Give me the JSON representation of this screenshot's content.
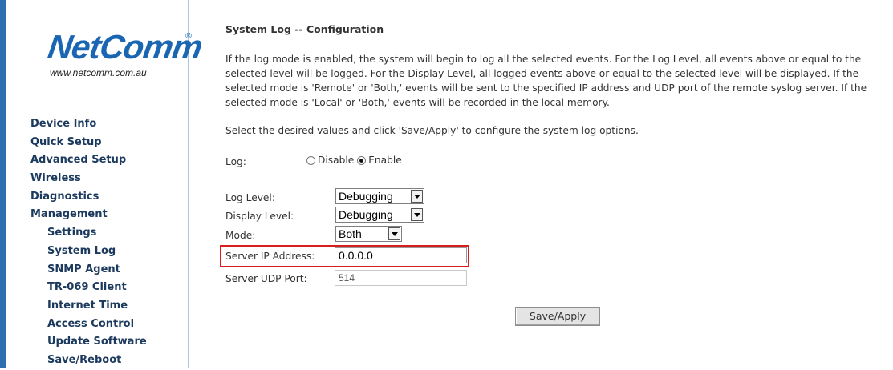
{
  "sidebar": {
    "logo_text": "NetComm",
    "logo_reg": "®",
    "logo_url": "www.netcomm.com.au",
    "items": [
      {
        "label": "Device Info"
      },
      {
        "label": "Quick Setup"
      },
      {
        "label": "Advanced Setup"
      },
      {
        "label": "Wireless"
      },
      {
        "label": "Diagnostics"
      },
      {
        "label": "Management"
      }
    ],
    "subitems": [
      {
        "label": "Settings"
      },
      {
        "label": "System Log"
      },
      {
        "label": "SNMP Agent"
      },
      {
        "label": "TR-069 Client"
      },
      {
        "label": "Internet Time"
      },
      {
        "label": "Access Control"
      },
      {
        "label": "Update Software"
      },
      {
        "label": "Save/Reboot"
      }
    ]
  },
  "main": {
    "title": "System Log -- Configuration",
    "description": "If the log mode is enabled, the system will begin to log all the selected events. For the Log Level, all events above or equal to the selected level will be logged. For the Display Level, all logged events above or equal to the selected level will be displayed. If the selected mode is 'Remote' or 'Both,' events will be sent to the specified IP address and UDP port of the remote syslog server. If the selected mode is 'Local' or 'Both,' events will be recorded in the local memory.",
    "instruction": "Select the desired values and click 'Save/Apply' to configure the system log options.",
    "log": {
      "label": "Log:",
      "disable_label": "Disable",
      "enable_label": "Enable",
      "selected": "Enable"
    },
    "log_level": {
      "label": "Log Level:",
      "value": "Debugging"
    },
    "display_level": {
      "label": "Display Level:",
      "value": "Debugging"
    },
    "mode": {
      "label": "Mode:",
      "value": "Both"
    },
    "server_ip": {
      "label": "Server IP Address:",
      "value": "0.0.0.0"
    },
    "server_port": {
      "label": "Server UDP Port:",
      "value": "514"
    },
    "save_label": "Save/Apply"
  },
  "colors": {
    "accent": "#2f6fb0",
    "nav_text": "#1c3a5e",
    "highlight": "#d81e1e"
  }
}
